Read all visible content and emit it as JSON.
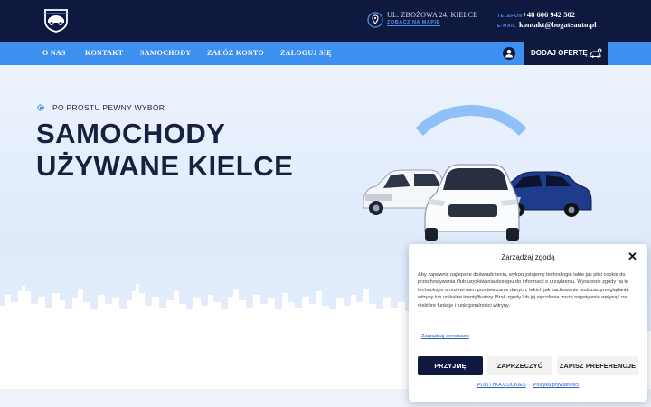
{
  "header": {
    "address": "UL. ZBOŻOWA 24, KIELCE",
    "map_link": "ZOBACZ NA MAPIE",
    "phone_label": "TELEFON",
    "phone": "+48 606 942 502",
    "email_label": "E-MAIL",
    "email": "kontakt@bogateauto.pl"
  },
  "nav": {
    "items": [
      {
        "label": "O NAS"
      },
      {
        "label": "KONTAKT"
      },
      {
        "label": "SAMOCHODY"
      },
      {
        "label": "ZAŁÓŻ KONTO"
      },
      {
        "label": "ZALOGUJ SIĘ"
      }
    ],
    "offer_button": "DODAJ OFERTĘ"
  },
  "hero": {
    "tagline": "PO PROSTU PEWNY WYBÓR",
    "title_line1": "SAMOCHODY",
    "title_line2": "UŻYWANE KIELCE"
  },
  "consent": {
    "title": "Zarządzaj zgodą",
    "close": "✕",
    "text": "Aby zapewnić najlepsze doświadczenia, wykorzystujemy technologie takie jak pliki cookie do przechowywania i/lub uzyskiwania dostępu do informacji o urządzeniu. Wyrażenie zgody na te technologie umożliwi nam przetwarzanie danych, takich jak zachowanie podczas przeglądania witryny lub unikalne identyfikatory. Brak zgody lub jej wycofanie może negatywnie wpłynąć na niektóre funkcje i funkcjonalności witryny.",
    "manage_services": "Zarządzaj serwisami",
    "accept": "PRZYJMĘ",
    "reject": "ZAPRZECZYĆ",
    "preferences": "ZAPISZ PREFERENCJE",
    "cookie_policy": "POLITYKA COOKIES",
    "privacy_policy": "Polityka prywatności"
  },
  "colors": {
    "navy": "#0f1940",
    "blue": "#3d8ff0",
    "accent_link": "#4f8fe6"
  }
}
